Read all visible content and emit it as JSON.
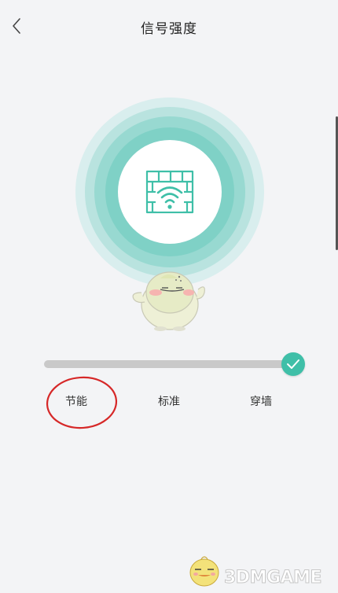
{
  "header": {
    "title": "信号强度",
    "back_icon": "chevron-left-icon"
  },
  "signal": {
    "icon": "wifi-wall-icon",
    "accent_color": "#3fbfa8"
  },
  "slider": {
    "levels": [
      "节能",
      "标准",
      "穿墙"
    ],
    "selected_index": 2,
    "selected_label": "穿墙",
    "thumb_icon": "check-icon"
  },
  "annotation": {
    "highlighted_level": "节能",
    "color": "#d62828"
  },
  "watermark": {
    "text": "3DMGAME"
  }
}
